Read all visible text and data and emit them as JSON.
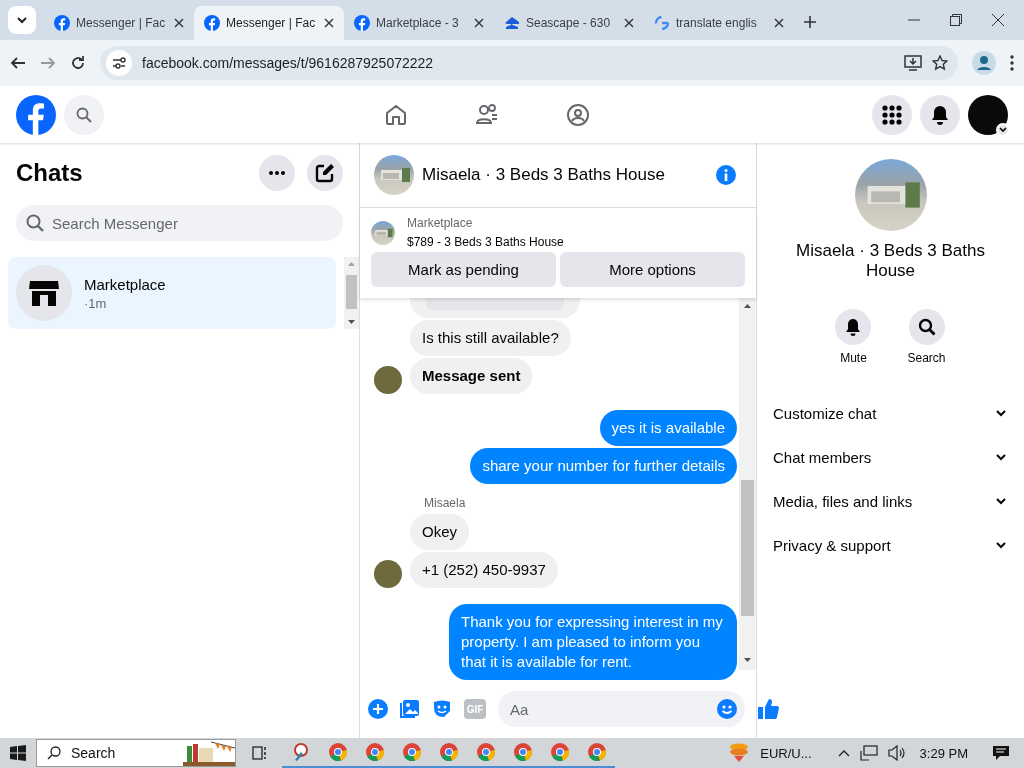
{
  "browser": {
    "tabs": [
      {
        "title": "Messenger | Fac",
        "kind": "facebook",
        "selected": false
      },
      {
        "title": "Messenger | Fac",
        "kind": "facebook",
        "selected": true
      },
      {
        "title": "Marketplace - 3",
        "kind": "facebook",
        "selected": false
      },
      {
        "title": "Seascape - 630",
        "kind": "house",
        "selected": false
      },
      {
        "title": "translate englis",
        "kind": "google",
        "selected": false
      }
    ],
    "url": "facebook.com/messages/t/9616287925072222"
  },
  "chats": {
    "title": "Chats",
    "search": {
      "placeholder": "Search Messenger"
    },
    "items": [
      {
        "name": "Marketplace",
        "time": "·1m",
        "selected": true
      }
    ]
  },
  "conversation": {
    "title": "Misaela · 3 Beds 3 Baths House",
    "listing": {
      "label": "Marketplace",
      "text": "$789 - 3 Beds 3 Baths House"
    },
    "actions": [
      "Mark as pending",
      "More options"
    ],
    "messages": [
      {
        "kind": "card",
        "avatar": false
      },
      {
        "kind": "incoming",
        "text": "Is this still available?",
        "avatar": false
      },
      {
        "kind": "incoming",
        "text": "Message sent",
        "emphasis": true,
        "avatar": true
      },
      {
        "kind": "outgoing",
        "text": "yes it is available"
      },
      {
        "kind": "outgoing",
        "text": "share your number for further details"
      },
      {
        "kind": "incoming",
        "sender": "Misaela",
        "text": "Okey",
        "avatar": false
      },
      {
        "kind": "incoming",
        "text": "+1 (252) 450-9937",
        "avatar": true
      },
      {
        "kind": "outgoing",
        "text": "Thank you for expressing interest in my property. I am pleased to inform you that it is available for rent."
      }
    ],
    "composer": {
      "gif_label": "GIF",
      "placeholder": "Aa"
    }
  },
  "info": {
    "title": "Misaela · 3 Beds 3 Baths House",
    "actions": [
      {
        "kind": "mute",
        "label": "Mute"
      },
      {
        "kind": "search",
        "label": "Search"
      }
    ],
    "sections": [
      "Customize chat",
      "Chat members",
      "Media, files and links",
      "Privacy & support"
    ]
  },
  "taskbar": {
    "search": "Search",
    "apps": [
      {
        "kind": "paint",
        "open": true
      },
      {
        "kind": "browser",
        "open": true
      },
      {
        "kind": "browser",
        "open": true
      },
      {
        "kind": "browser",
        "open": true
      },
      {
        "kind": "browser",
        "open": true
      },
      {
        "kind": "browser",
        "open": true
      },
      {
        "kind": "browser",
        "open": true
      },
      {
        "kind": "browser",
        "open": true
      },
      {
        "kind": "browser",
        "open": true
      }
    ],
    "widget": "EUR/U...",
    "time": "3:29 PM"
  }
}
